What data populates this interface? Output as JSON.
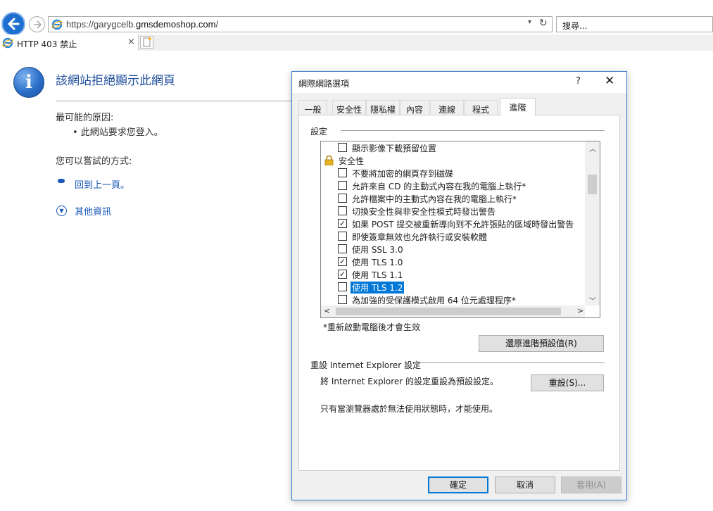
{
  "browser": {
    "url_prefix": "https://garygcelb.",
    "url_domain": "gmsdemoshop.com",
    "url_suffix": "/",
    "search_placeholder": "搜尋...",
    "tab_title": "HTTP 403 禁止",
    "tab_close": "×"
  },
  "error_page": {
    "title": "該網站拒絕顯示此網頁",
    "reason_heading": "最可能的原因:",
    "reason_item": "•  此網站要求您登入。",
    "try_heading": "您可以嘗試的方式:",
    "back_link": "回到上一頁。",
    "more_info_link": "其他資訊"
  },
  "dialog": {
    "title": "網際網路選項",
    "help": "?",
    "close": "✕",
    "tabs": [
      "一般",
      "安全性",
      "隱私權",
      "內容",
      "連線",
      "程式",
      "進階"
    ],
    "active_tab": "進階",
    "settings_label": "設定",
    "tree": [
      {
        "type": "checkbox",
        "label": "顯示影像下載預留位置",
        "checked": false
      },
      {
        "type": "group",
        "label": "安全性",
        "icon": "lock-icon"
      },
      {
        "type": "checkbox",
        "label": "不要將加密的網頁存到磁碟",
        "checked": false
      },
      {
        "type": "checkbox",
        "label": "允許來自 CD 的主動式內容在我的電腦上執行*",
        "checked": false
      },
      {
        "type": "checkbox",
        "label": "允許檔案中的主動式內容在我的電腦上執行*",
        "checked": false
      },
      {
        "type": "checkbox",
        "label": "切換安全性與非安全性模式時發出警告",
        "checked": false
      },
      {
        "type": "checkbox",
        "label": "如果 POST 提交被重新導向到不允許張貼的區域時發出警告",
        "checked": true
      },
      {
        "type": "checkbox",
        "label": "即使簽章無效也允許執行或安裝軟體",
        "checked": false
      },
      {
        "type": "checkbox",
        "label": "使用 SSL 3.0",
        "checked": false
      },
      {
        "type": "checkbox",
        "label": "使用 TLS 1.0",
        "checked": true
      },
      {
        "type": "checkbox",
        "label": "使用 TLS 1.1",
        "checked": true
      },
      {
        "type": "checkbox",
        "label": "使用 TLS 1.2",
        "checked": false,
        "selected": true
      },
      {
        "type": "checkbox",
        "label": "為加強的受保護模式啟用 64 位元處理程序*",
        "checked": false
      }
    ],
    "restart_note": "*重新啟動電腦後才會生效",
    "restore_button": "還原進階預設值(R)",
    "reset_group_label": "重設 Internet Explorer 設定",
    "reset_description": "將 Internet Explorer 的設定重設為預設設定。",
    "reset_button": "重設(S)...",
    "reset_note": "只有當瀏覽器處於無法使用狀態時，才能使用。",
    "ok_button": "確定",
    "cancel_button": "取消",
    "apply_button": "套用(A)"
  },
  "colors": {
    "accent": "#0078d7",
    "link": "#1a58b6",
    "title_blue": "#1f4e9c"
  }
}
